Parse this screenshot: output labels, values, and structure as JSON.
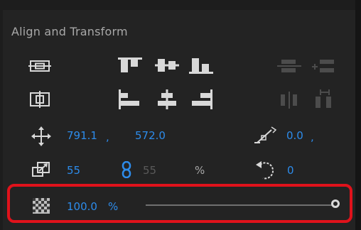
{
  "panel": {
    "title": "Align and Transform"
  },
  "align": {
    "row1_icons": [
      "align-to-selection-horizontal-icon",
      "align-top-icon",
      "align-vertical-center-icon",
      "align-bottom-icon",
      "distribute-vertical-icon",
      "distribute-vertical-spacing-icon"
    ],
    "row2_icons": [
      "align-to-selection-vertical-icon",
      "align-left-icon",
      "align-horizontal-center-icon",
      "align-right-icon",
      "distribute-horizontal-icon",
      "distribute-horizontal-spacing-icon"
    ]
  },
  "transform": {
    "position_x": "791.1",
    "position_sep": ",",
    "position_y": "572.0",
    "rotation": "0.0",
    "rotation_sep": ",",
    "scale_width": "55",
    "scale_height": "55",
    "scale_unit": "%",
    "anchor": "0",
    "opacity_value": "100.0",
    "opacity_unit": "%",
    "opacity_fraction": 1.0
  },
  "colors": {
    "accent": "#2d8ceb",
    "highlight": "#e0121b",
    "panel_bg": "#232323"
  }
}
